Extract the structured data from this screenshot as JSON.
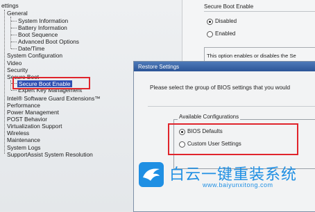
{
  "tree": {
    "root": "ettings",
    "general": "General",
    "general_children": [
      "System Information",
      "Battery Information",
      "Boot Sequence",
      "Advanced Boot Options",
      "Date/Time"
    ],
    "system_configuration": "System Configuration",
    "video": "Video",
    "security": "Security",
    "secure_boot": "Secure Boot",
    "secure_boot_children": [
      "Secure Boot Enable",
      "Expert Key Management"
    ],
    "others": [
      "Intel® Software Guard Extensions™",
      "Performance",
      "Power Management",
      "POST Behavior",
      "Virtualization Support",
      "Wireless",
      "Maintenance",
      "System Logs",
      "SupportAssist System Resolution"
    ]
  },
  "background_panel": {
    "title": "Secure Boot Enable",
    "options": [
      "Disabled",
      "Enabled"
    ],
    "selected": "Disabled",
    "description": "This option enables or disables the Se"
  },
  "dialog": {
    "title": "Restore Settings",
    "message": "Please select the group of BIOS settings that you would",
    "group_label": "Available Configurations",
    "options": [
      "BIOS Defaults",
      "Custom User Settings"
    ],
    "selected": "BIOS Defaults"
  },
  "watermark": {
    "brand": "白云一键重装系统",
    "url": "www.baiyunxitong.com"
  },
  "colors": {
    "highlight": "#e0242b",
    "selection": "#2f4fb3",
    "titlebar": "#2c5597",
    "watermark": "#1f8fe3"
  }
}
